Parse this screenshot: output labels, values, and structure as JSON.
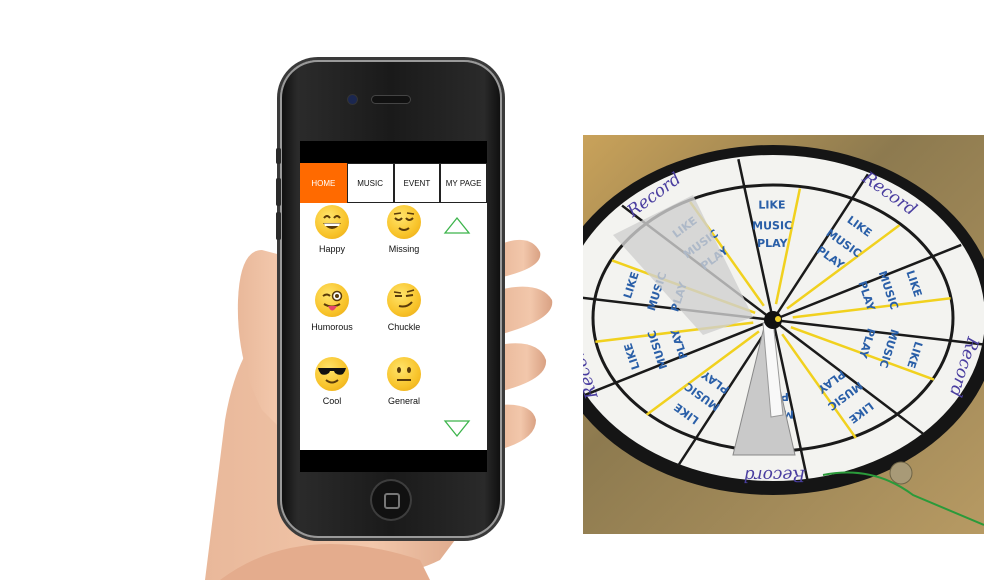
{
  "phone_app": {
    "tabs": [
      {
        "label": "HOME",
        "active": true
      },
      {
        "label": "MUSIC",
        "active": false
      },
      {
        "label": "EVENT",
        "active": false
      },
      {
        "label": "MY PAGE",
        "active": false
      }
    ],
    "emotions": [
      {
        "label": "Happy",
        "icon": "grinning-face-icon"
      },
      {
        "label": "Missing",
        "icon": "relieved-face-icon"
      },
      {
        "label": "Humorous",
        "icon": "winking-tongue-face-icon"
      },
      {
        "label": "Chuckle",
        "icon": "smirking-face-icon"
      },
      {
        "label": "Cool",
        "icon": "sunglasses-face-icon"
      },
      {
        "label": "General",
        "icon": "neutral-face-icon"
      }
    ],
    "colors": {
      "active_tab": "#ff6a00",
      "arrow": "#3cb44b",
      "emoji": "#f8c32a"
    }
  },
  "wheel_photo": {
    "sector_labels": {
      "like": "LIKE",
      "play": "PLAY",
      "music": "MUSIC",
      "record": "Record"
    }
  }
}
